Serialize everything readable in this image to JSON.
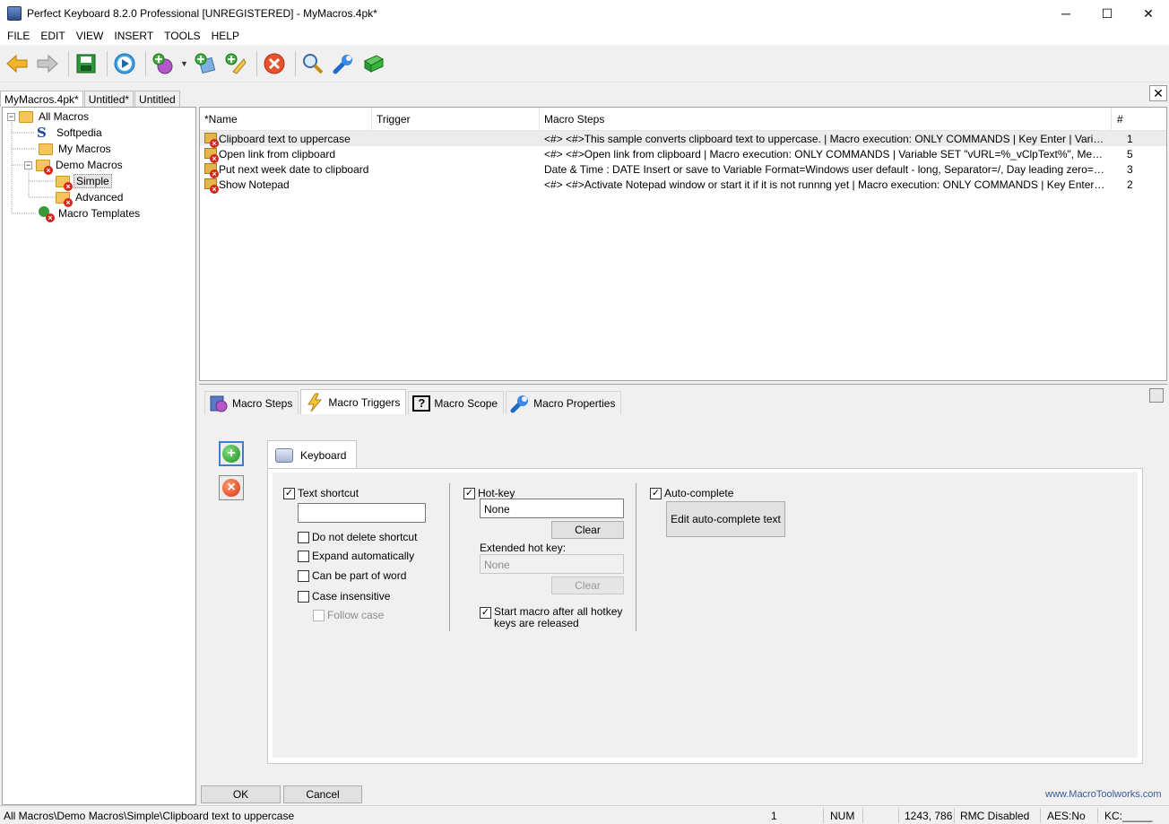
{
  "window": {
    "title": "Perfect Keyboard 8.2.0 Professional [UNREGISTERED] - MyMacros.4pk*",
    "minimize": "─",
    "maximize": "☐",
    "close": "✕"
  },
  "menu": [
    "FILE",
    "EDIT",
    "VIEW",
    "INSERT",
    "TOOLS",
    "HELP"
  ],
  "toolbar": {
    "icons": [
      "back-icon",
      "forward-icon",
      "save-icon",
      "play-icon",
      "add-macro-icon",
      "add-clipboard-icon",
      "add-text-icon",
      "delete-icon",
      "search-icon",
      "wrench-icon",
      "help-book-icon"
    ],
    "dropdown_arrow": "▼"
  },
  "doc_tabs": [
    "MyMacros.4pk*",
    "Untitled*",
    "Untitled"
  ],
  "close_doc": "✕",
  "tree": {
    "items": [
      {
        "label": "All Macros",
        "expander": "−"
      },
      {
        "label": "Softpedia",
        "logo": "S"
      },
      {
        "label": "My Macros"
      },
      {
        "label": "Demo Macros",
        "expander": "−"
      },
      {
        "label": "Simple"
      },
      {
        "label": "Advanced"
      },
      {
        "label": "Macro Templates"
      }
    ]
  },
  "list": {
    "columns": [
      "*Name",
      "Trigger",
      "Macro Steps",
      "#"
    ],
    "rows": [
      {
        "name": "Clipboard text to uppercase",
        "trigger": "",
        "steps": "<#> <#>This sample converts clipboard text to uppercase. | Macro execution: ONLY COMMANDS | Key Enter | Variable OPERATI...",
        "count": "1"
      },
      {
        "name": "Open link from clipboard",
        "trigger": "",
        "steps": "<#> <#>Open link from clipboard | Macro execution: ONLY COMMANDS | Variable SET \"vURL=%_vClpText%\", Message text=\"<n...",
        "count": "5"
      },
      {
        "name": "Put next week date to clipboard",
        "trigger": "",
        "steps": "Date & Time : DATE Insert or save to Variable Format=Windows user default - long, Separator=/, Day leading zero=Yes, Month lea...",
        "count": "3"
      },
      {
        "name": "Show Notepad",
        "trigger": "",
        "steps": "<#> <#>Activate Notepad window or start it if it is not runnng yet | Macro execution: ONLY COMMANDS | Key Enter | Key Enter | IF...",
        "count": "2"
      }
    ]
  },
  "panel_tabs": [
    {
      "label": "Macro Steps",
      "icon": "macro-steps-icon"
    },
    {
      "label": "Macro Triggers",
      "icon": "lightning-icon"
    },
    {
      "label": "Macro Scope",
      "icon": "question-icon",
      "glyph": "?"
    },
    {
      "label": "Macro Properties",
      "icon": "wrench-icon"
    }
  ],
  "side_buttons": {
    "add": "+",
    "remove": "×"
  },
  "keyboard_tab": "Keyboard",
  "triggers": {
    "text_shortcut": {
      "label": "Text shortcut",
      "checked": "✓",
      "value": ""
    },
    "do_not_delete": "Do not delete shortcut",
    "expand_auto": "Expand automatically",
    "part_of_word": "Can be part of word",
    "case_insensitive": "Case insensitive",
    "follow_case": "Follow case",
    "hotkey": {
      "label": "Hot-key",
      "checked": "✓",
      "value": "None",
      "clear": "Clear"
    },
    "extended": {
      "label": "Extended hot key:",
      "value": "None",
      "clear": "Clear"
    },
    "start_after_release": {
      "line1": "Start macro after all hotkey",
      "line2": "keys are released",
      "checked": "✓"
    },
    "auto_complete": {
      "label": "Auto-complete",
      "checked": "✓",
      "button": "Edit auto-complete text"
    }
  },
  "footer": {
    "ok": "OK",
    "cancel": "Cancel",
    "website": "www.MacroToolworks.com"
  },
  "status": {
    "path": "All Macros\\Demo Macros\\Simple\\Clipboard text to uppercase",
    "count": "1",
    "num": "NUM",
    "coords": "1243, 786",
    "rmc": "RMC Disabled",
    "aes": "AES:No",
    "kc": "KC:_____"
  },
  "colors": {
    "accent": "#3c7fd0",
    "error_red": "#d8231b",
    "folder": "#f5c45b"
  }
}
